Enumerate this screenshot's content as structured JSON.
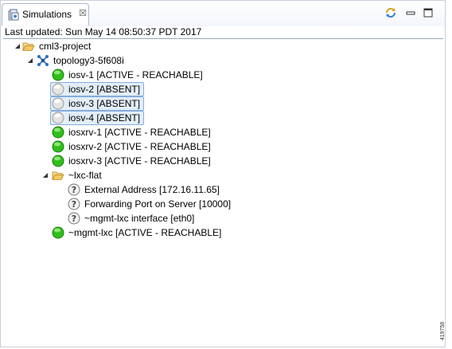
{
  "view": {
    "tab_title": "Simulations",
    "tab_close": "☒",
    "last_updated": "Last updated: Sun May 14 08:50:37 PDT 2017"
  },
  "tree": {
    "project": "cml3-project",
    "topology": "topology3-5f608i",
    "nodes": [
      {
        "label": "iosv-1  [ACTIVE - REACHABLE]",
        "state": "active"
      },
      {
        "label": "iosv-2  [ABSENT]",
        "state": "absent"
      },
      {
        "label": "iosv-3  [ABSENT]",
        "state": "absent"
      },
      {
        "label": "iosv-4  [ABSENT]",
        "state": "absent"
      },
      {
        "label": "iosxrv-1  [ACTIVE - REACHABLE]",
        "state": "active"
      },
      {
        "label": "iosxrv-2  [ACTIVE - REACHABLE]",
        "state": "active"
      },
      {
        "label": "iosxrv-3  [ACTIVE - REACHABLE]",
        "state": "active"
      }
    ],
    "lxc_folder": "~lxc-flat",
    "lxc_props": [
      {
        "label": "External Address  [172.16.11.65]"
      },
      {
        "label": "Forwarding Port on Server  [10000]"
      },
      {
        "label": "~mgmt-lxc interface  [eth0]"
      }
    ],
    "mgmt_node": {
      "label": "~mgmt-lxc  [ACTIVE - REACHABLE]",
      "state": "active"
    }
  },
  "figure_code": "419758",
  "icons": {
    "tab": "simulations-view-icon",
    "sync": "sync-icon",
    "minimize": "minimize-icon",
    "maximize": "maximize-icon",
    "folder": "folder-open-icon",
    "topology": "topology-icon",
    "active": "green-status-icon",
    "absent": "grey-status-icon",
    "info": "question-icon"
  },
  "colors": {
    "active": "#2fbf1a",
    "absent": "#d9d9d9",
    "selection_border": "#84acdd",
    "selection_fill": "#e3eef9",
    "folder": "#f5c862"
  }
}
